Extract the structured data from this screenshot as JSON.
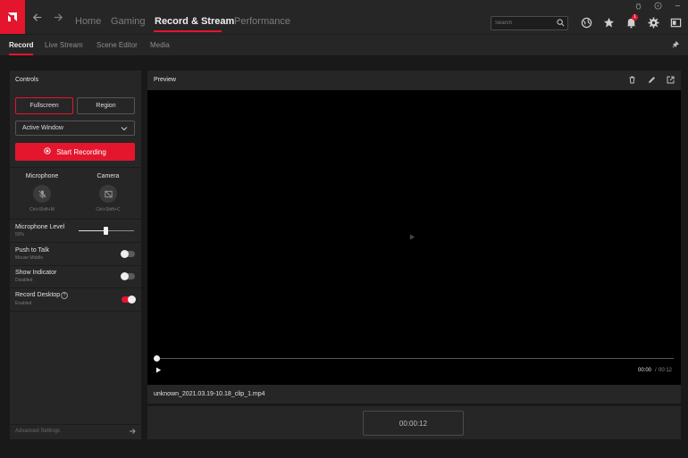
{
  "topbar": {
    "tabs": [
      {
        "label": "Home",
        "active": false
      },
      {
        "label": "Gaming",
        "active": false
      },
      {
        "label": "Record & Stream",
        "active": true
      },
      {
        "label": "Performance",
        "active": false
      }
    ],
    "search_placeholder": "Search",
    "notification_count": "1",
    "icons": [
      "back-icon",
      "forward-icon",
      "globe-icon",
      "star-icon",
      "bell-icon",
      "gear-icon",
      "panel-icon",
      "bug-icon",
      "help-icon",
      "minimize-icon"
    ]
  },
  "subtabs": [
    {
      "label": "Record",
      "active": true
    },
    {
      "label": "Live Stream",
      "active": false
    },
    {
      "label": "Scene Editor",
      "active": false
    },
    {
      "label": "Media",
      "active": false
    }
  ],
  "controls": {
    "title": "Controls",
    "mode_fullscreen": "Fullscreen",
    "mode_region": "Region",
    "source": "Active Window",
    "start_label": "Start Recording",
    "microphone": {
      "title": "Microphone",
      "shortcut": "Ctrl+Shift+M"
    },
    "camera": {
      "title": "Camera",
      "shortcut": "Ctrl+Shift+C"
    },
    "mic_level": {
      "title": "Microphone Level",
      "value": "50%"
    },
    "push_to_talk": {
      "title": "Push to Talk",
      "sub": "Mouse Middle",
      "on": false
    },
    "show_indicator": {
      "title": "Show Indicator",
      "sub": "Disabled",
      "on": false
    },
    "record_desktop": {
      "title": "Record Desktop",
      "sub": "Enabled",
      "on": true
    },
    "advanced": "Advanced Settings"
  },
  "preview": {
    "title": "Preview",
    "current_time": "00:00",
    "separator": "/",
    "total_time": "00:12",
    "filename": "unknown_2021.03.19-10.18_clip_1.mp4",
    "duration": "00:00:12"
  },
  "colors": {
    "accent": "#e3162e",
    "panel": "#262626",
    "background": "#191919"
  }
}
